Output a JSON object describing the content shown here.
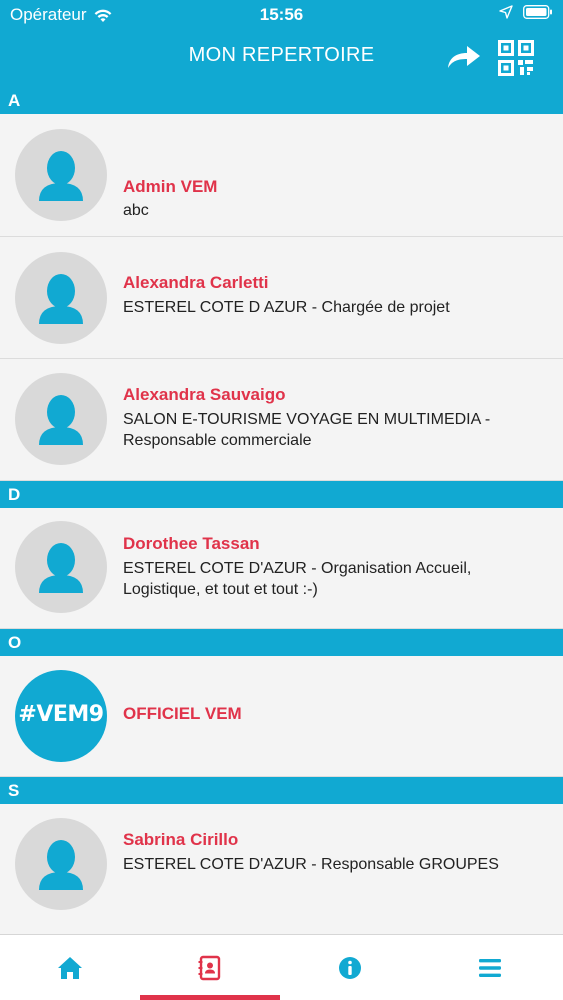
{
  "status_bar": {
    "carrier": "Opérateur",
    "time": "15:56"
  },
  "header": {
    "title": "MON REPERTOIRE"
  },
  "sections": [
    {
      "letter": "A",
      "contacts": [
        {
          "name": "Admin VEM",
          "subtitle": "abc"
        },
        {
          "name": "Alexandra Carletti",
          "subtitle": "ESTEREL COTE D AZUR - Chargée de projet"
        },
        {
          "name": "Alexandra Sauvaigo",
          "subtitle": "SALON E-TOURISME VOYAGE EN MULTIMEDIA - Responsable commerciale"
        }
      ]
    },
    {
      "letter": "D",
      "contacts": [
        {
          "name": "Dorothee Tassan",
          "subtitle": "ESTEREL COTE D'AZUR - Organisation Accueil, Logistique, et tout et tout :-)"
        }
      ]
    },
    {
      "letter": "O",
      "contacts": [
        {
          "name": "OFFICIEL VEM",
          "subtitle": "",
          "avatar_text": "#VEM9"
        }
      ]
    },
    {
      "letter": "S",
      "contacts": [
        {
          "name": "Sabrina Cirillo",
          "subtitle": "ESTEREL COTE D'AZUR - Responsable GROUPES"
        }
      ]
    }
  ],
  "tabs": [
    {
      "icon": "home-icon",
      "active": false
    },
    {
      "icon": "contacts-book-icon",
      "active": true
    },
    {
      "icon": "info-icon",
      "active": false
    },
    {
      "icon": "menu-icon",
      "active": false
    }
  ],
  "colors": {
    "accent": "#11a9d2",
    "name": "#e0334a",
    "indicator": "#e0334a"
  }
}
